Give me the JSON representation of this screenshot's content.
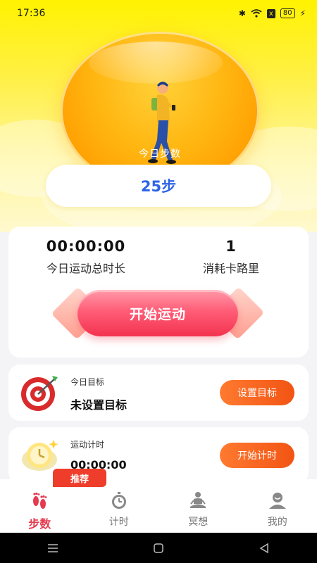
{
  "status_bar": {
    "time": "17:36",
    "battery": "80",
    "indicator": "x"
  },
  "hero": {
    "label": "今日步数",
    "steps": "25步"
  },
  "stats": {
    "duration_value": "00:00:00",
    "duration_label": "今日运动总时长",
    "calories_value": "1",
    "calories_label": "消耗卡路里"
  },
  "start_button": "开始运动",
  "goal_card": {
    "sub": "今日目标",
    "title": "未设置目标",
    "button": "设置目标"
  },
  "timer_card": {
    "sub": "运动计时",
    "title": "00:00:00",
    "button": "开始计时",
    "badge": "推荐"
  },
  "tabs": [
    {
      "label": "步数",
      "icon": "footprints-icon",
      "active": true
    },
    {
      "label": "计时",
      "icon": "stopwatch-icon",
      "active": false
    },
    {
      "label": "冥想",
      "icon": "meditation-icon",
      "active": false
    },
    {
      "label": "我的",
      "icon": "profile-icon",
      "active": false
    }
  ],
  "colors": {
    "accent_blue": "#2f63e6",
    "accent_red": "#e33b4f",
    "button_orange": "#f25413",
    "hero_yellow": "#fff200"
  }
}
